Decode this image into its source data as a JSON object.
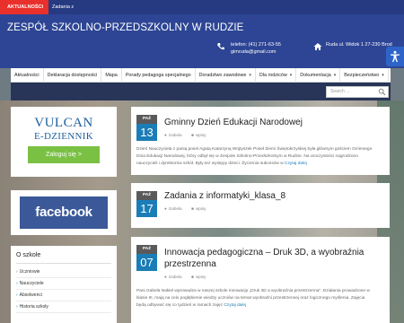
{
  "topbar": {
    "tag": "AKTUALNOŚCI",
    "news": "Zadania z"
  },
  "header": {
    "title": "ZESPÓŁ SZKOLNO-PRZEDSZKOLNY W RUDZIE",
    "phone": "telefon: (41) 271-63-55",
    "email": "gimruda@gmail.com",
    "address": "Ruda ul. Widok 1 27-230 Brod"
  },
  "nav": {
    "items": [
      {
        "label": "Aktualności",
        "chevron": false
      },
      {
        "label": "Deklaracja dostępności",
        "chevron": false
      },
      {
        "label": "Mapa",
        "chevron": false
      },
      {
        "label": "Porady pedagoga specjalnego",
        "chevron": false
      },
      {
        "label": "Doradztwo zawodowe",
        "chevron": true
      },
      {
        "label": "Dla rodziców",
        "chevron": true
      },
      {
        "label": "Dokumentacja",
        "chevron": true
      },
      {
        "label": "Bezpieczeństwo",
        "chevron": true
      }
    ]
  },
  "search": {
    "placeholder": "Search ..."
  },
  "sidebar": {
    "vulcan": {
      "title": "VULCAN",
      "subtitle": "E-DZIENNIK",
      "button": "Zaloguj się >"
    },
    "facebook": {
      "label": "facebook"
    },
    "oszkole": {
      "heading": "O szkole",
      "items": [
        "Uczniowie",
        "Nauczyciele",
        "Absolwenci",
        "Historia szkoły"
      ]
    }
  },
  "posts": [
    {
      "month": "PAŹ",
      "day": "13",
      "title": [
        "Gminny Dzień Edukacji Narodowej"
      ],
      "author": "Izabela",
      "category": "wpisy",
      "excerpt": [
        "Dzień Nauczyciela z panią posel Agatą Katarzyną Wojtyszek Poseł Ziemi Świętokrzyskiej była głównym gościem Gminnego",
        "Dnia Edukacji Narodowej, który odbył się w Zespole Szkolno-Przedszkolnym w Rudzie. Na uroczystości nagrodzono",
        "nauczycieli i dyrektorów szkół. Były też występy dzieci.  Życzenia sukcesów w"
      ],
      "read_more": "Czytaj dalej"
    },
    {
      "month": "PAŹ",
      "day": "17",
      "title": [
        "Zadania z informatyki_klasa_8"
      ],
      "author": "Izabela",
      "category": "wpisy"
    },
    {
      "month": "PAŹ",
      "day": "07",
      "title": [
        "Innowacja pedagogiczna – Druk 3D, a wyobraźnia",
        "przestrzenna"
      ],
      "author": "Izabela",
      "category": "wpisy",
      "excerpt": [
        "Pani Izabela Nakiel wprowadza w naszej szkole innowację „Druk 3D a wyobraźnia przestrzenna\". Działania prowadzone w",
        "klasie III, mają na celu pogłębienie wiedzy uczniów na temat wyobraźni przestrzennej oraz logicznego myślenia. Zajęcia",
        "będą odbywać się co tydzień w ramach zajęć"
      ],
      "read_more": "Czytaj dalej"
    }
  ],
  "colors": {
    "header": "#2d4594",
    "accent": "#1b7db7",
    "tag": "#e9302d",
    "vulcan_green": "#7ac143",
    "facebook": "#3b5998"
  }
}
